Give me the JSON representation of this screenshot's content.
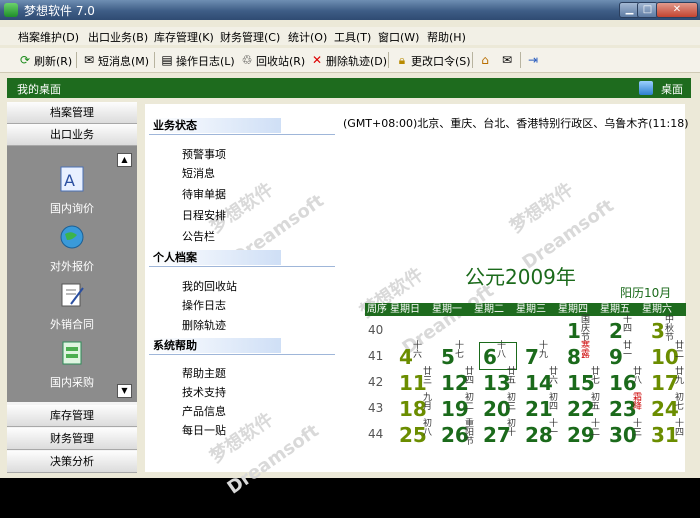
{
  "window": {
    "title": "梦想软件 7.0",
    "btn_min": "▁",
    "btn_max": "□",
    "btn_close": "✕"
  },
  "menu": [
    "档案维护(D)",
    "出口业务(B)",
    "库存管理(K)",
    "财务管理(C)",
    "统计(O)",
    "工具(T)",
    "窗口(W)",
    "帮助(H)"
  ],
  "toolbar": {
    "refresh": "刷新(R)",
    "sms": "短消息(M)",
    "oplog": "操作日志(L)",
    "recycle": "回收站(R)",
    "delete_trace": "删除轨迹(D)",
    "change_password": "更改口令(S)"
  },
  "desktop": {
    "title": "我的桌面",
    "right_label": "桌面"
  },
  "sidebar": {
    "sections_top": [
      "档案管理",
      "出口业务"
    ],
    "items": [
      "国内询价",
      "对外报价",
      "外销合同",
      "国内采购"
    ],
    "sections_bottom": [
      "库存管理",
      "财务管理",
      "决策分析"
    ],
    "scroll_up": "▲",
    "scroll_down": "▼"
  },
  "main": {
    "timezone": "(GMT+08:00)北京、重庆、台北、香港特别行政区、乌鲁木齐(11:18)",
    "sections": [
      {
        "title": "业务状态",
        "links": [
          "预警事项",
          "短消息",
          "待审单据",
          "日程安排",
          "公告栏"
        ]
      },
      {
        "title": "个人档案",
        "links": [
          "我的回收站",
          "操作日志",
          "删除轨迹"
        ]
      },
      {
        "title": "系统帮助",
        "links": [
          "帮助主题",
          "技术支持",
          "产品信息",
          "每日一贴"
        ]
      }
    ],
    "watermark_cn": "梦想软件",
    "watermark_en": "Dreamsoft"
  },
  "calendar": {
    "title": "公元2009年",
    "lunar_month": "阳历10月",
    "headers": [
      "周序",
      "星期日",
      "星期一",
      "星期二",
      "星期三",
      "星期四",
      "星期五",
      "星期六"
    ],
    "weeks": [
      "40",
      "41",
      "42",
      "43",
      "44"
    ],
    "days": [
      {
        "n": "1",
        "l": "国庆节",
        "week": 0,
        "col": 4,
        "red": false
      },
      {
        "n": "2",
        "l": "十四",
        "week": 0,
        "col": 5,
        "red": false
      },
      {
        "n": "3",
        "l": "中秋节",
        "week": 0,
        "col": 6,
        "red": false
      },
      {
        "n": "4",
        "l": "十六",
        "week": 1,
        "col": 0,
        "red": false
      },
      {
        "n": "5",
        "l": "十七",
        "week": 1,
        "col": 1,
        "red": false
      },
      {
        "n": "6",
        "l": "十八",
        "week": 1,
        "col": 2,
        "red": false
      },
      {
        "n": "7",
        "l": "十九",
        "week": 1,
        "col": 3,
        "red": false
      },
      {
        "n": "8",
        "l": "寒露",
        "week": 1,
        "col": 4,
        "red": true
      },
      {
        "n": "9",
        "l": "廿一",
        "week": 1,
        "col": 5,
        "red": false
      },
      {
        "n": "10",
        "l": "廿二",
        "week": 1,
        "col": 6,
        "red": false
      },
      {
        "n": "11",
        "l": "廿三",
        "week": 2,
        "col": 0,
        "red": false
      },
      {
        "n": "12",
        "l": "廿四",
        "week": 2,
        "col": 1,
        "red": false
      },
      {
        "n": "13",
        "l": "廿五",
        "week": 2,
        "col": 2,
        "red": false
      },
      {
        "n": "14",
        "l": "廿六",
        "week": 2,
        "col": 3,
        "red": false
      },
      {
        "n": "15",
        "l": "廿七",
        "week": 2,
        "col": 4,
        "red": false
      },
      {
        "n": "16",
        "l": "廿八",
        "week": 2,
        "col": 5,
        "red": false
      },
      {
        "n": "17",
        "l": "廿九",
        "week": 2,
        "col": 6,
        "red": false
      },
      {
        "n": "18",
        "l": "九月",
        "week": 3,
        "col": 0,
        "red": false
      },
      {
        "n": "19",
        "l": "初二",
        "week": 3,
        "col": 1,
        "red": false
      },
      {
        "n": "20",
        "l": "初三",
        "week": 3,
        "col": 2,
        "red": false
      },
      {
        "n": "21",
        "l": "初四",
        "week": 3,
        "col": 3,
        "red": false
      },
      {
        "n": "22",
        "l": "初五",
        "week": 3,
        "col": 4,
        "red": false
      },
      {
        "n": "23",
        "l": "霜降",
        "week": 3,
        "col": 5,
        "red": true
      },
      {
        "n": "24",
        "l": "初七",
        "week": 3,
        "col": 6,
        "red": false
      },
      {
        "n": "25",
        "l": "初八",
        "week": 4,
        "col": 0,
        "red": false
      },
      {
        "n": "26",
        "l": "重阳节",
        "week": 4,
        "col": 1,
        "red": false
      },
      {
        "n": "27",
        "l": "初十",
        "week": 4,
        "col": 2,
        "red": false
      },
      {
        "n": "28",
        "l": "十一",
        "week": 4,
        "col": 3,
        "red": false
      },
      {
        "n": "29",
        "l": "十二",
        "week": 4,
        "col": 4,
        "red": false
      },
      {
        "n": "30",
        "l": "十三",
        "week": 4,
        "col": 5,
        "red": false
      },
      {
        "n": "31",
        "l": "十四",
        "week": 4,
        "col": 6,
        "red": false
      }
    ],
    "today": "6"
  }
}
